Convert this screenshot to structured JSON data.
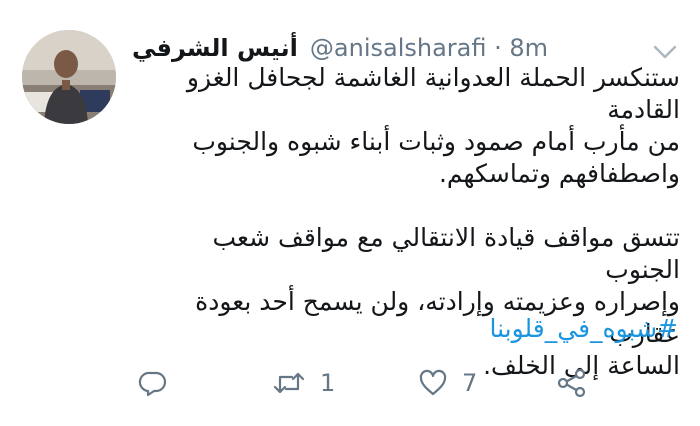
{
  "tweet": {
    "author_name": "أنيس الشرفي",
    "handle": "@anisalsharafi",
    "separator": "·",
    "time": "8m",
    "paragraphs": [
      [
        "ستنكسر الحملة العدوانية الغاشمة لجحافل الغزو القادمة",
        "من مأرب أمام صمود وثبات أبناء شبوه والجنوب",
        "واصطفافهم وتماسكهم."
      ],
      [
        "تتسق مواقف قيادة الانتقالي مع مواقف شعب الجنوب",
        "وإصراره وعزيمته وإرادته، ولن يسمح أحد بعودة عقارب",
        "الساعة إلى الخلف."
      ]
    ],
    "hashtag": "#شبوه_في_قلوبنا"
  },
  "actions": {
    "reply_icon": "reply-icon",
    "retweet_icon": "retweet-icon",
    "retweet_count": "1",
    "like_icon": "heart-icon",
    "like_count": "7",
    "share_icon": "share-icon"
  },
  "colors": {
    "text": "#14171a",
    "secondary": "#657786",
    "link": "#1b95e0"
  }
}
